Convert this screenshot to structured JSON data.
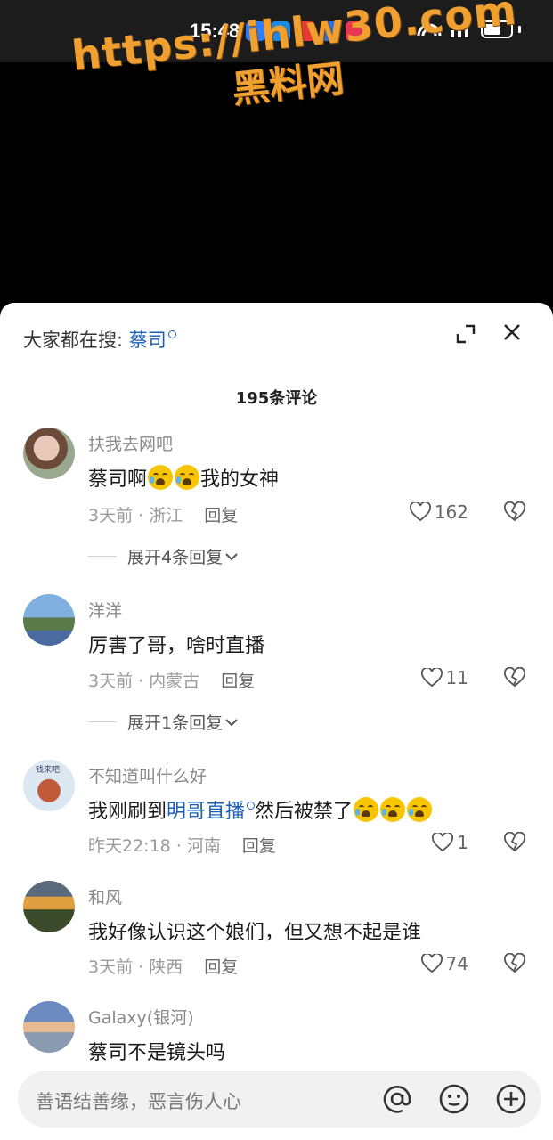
{
  "status_bar": {
    "time": "15:48"
  },
  "watermark": {
    "line1": "https://ihlw30.com",
    "line2": "黑料网"
  },
  "sheet": {
    "search_prefix": "大家都在搜:",
    "search_term": "蔡司",
    "comment_count": "195条评论"
  },
  "comments": [
    {
      "user": "扶我去网吧",
      "text_a": "蔡司啊",
      "text_b": "我的女神",
      "time": "3天前",
      "region": "浙江",
      "reply": "回复",
      "likes": "162",
      "expand": "展开4条回复"
    },
    {
      "user": "洋洋",
      "text": "厉害了哥，啥时直播",
      "time": "3天前",
      "region": "内蒙古",
      "reply": "回复",
      "likes": "11",
      "expand": "展开1条回复"
    },
    {
      "user": "不知道叫什么好",
      "avatar_text": "钱来吧",
      "text_a": "我刚刷到",
      "text_link": "明哥直播",
      "text_b": "然后被禁了",
      "time": "昨天22:18",
      "region": "河南",
      "reply": "回复",
      "likes": "1"
    },
    {
      "user": "和风",
      "text": "我好像认识这个娘们，但又想不起是谁",
      "time": "3天前",
      "region": "陕西",
      "reply": "回复",
      "likes": "74"
    },
    {
      "user": "Galaxy(银河)",
      "text": "蔡司不是镜头吗"
    }
  ],
  "input": {
    "placeholder": "善语结善缘，恶言伤人心"
  },
  "icons": [
    "search-icon",
    "expand-icon",
    "close-icon",
    "heart-icon",
    "broken-heart-icon",
    "chevron-down-icon",
    "at-icon",
    "emoji-icon",
    "add-icon"
  ],
  "colors": {
    "link": "#1a5fb4",
    "watermark": "#f0a030",
    "sheet_bg": "#ffffff"
  }
}
